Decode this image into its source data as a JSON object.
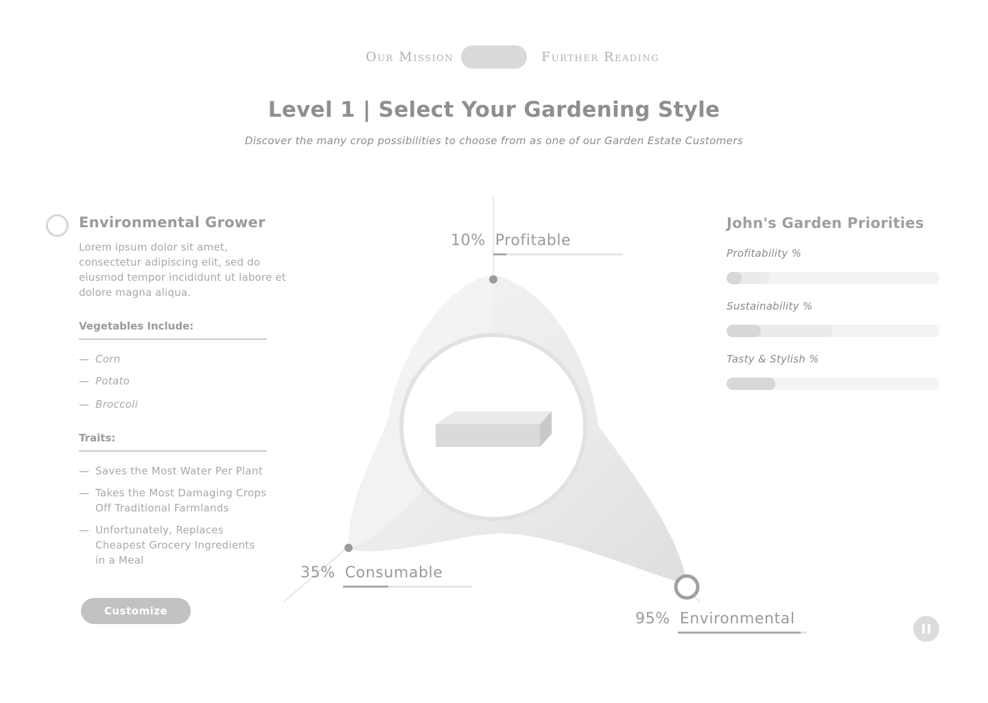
{
  "nav": {
    "left_link": "Our Mission",
    "right_link": "Further Reading"
  },
  "header": {
    "title": "Level 1 | Select Your Gardening Style",
    "subtitle": "Discover the many crop possibilities to choose from as one of our Garden Estate Customers"
  },
  "persona": {
    "title": "Environmental Grower",
    "description": "Lorem ipsum dolor sit amet, consectetur adipiscing elit, sed do eiusmod tempor incididunt ut labore et dolore magna aliqua.",
    "vegetables_heading": "Vegetables Include:",
    "vegetables": [
      "Corn",
      "Potato",
      "Broccoli"
    ],
    "traits_heading": "Traits:",
    "traits": [
      "Saves the Most Water Per Plant",
      "Takes the Most Damaging Crops Off Traditional Farmlands",
      "Unfortunately, Replaces Cheapest Grocery Ingredients in a Meal"
    ],
    "dash": "—",
    "customize_label": "Customize"
  },
  "chart": {
    "profitable": {
      "pct": "10%",
      "label": "Profitable",
      "value": 0.1
    },
    "consumable": {
      "pct": "35%",
      "label": "Consumable",
      "value": 0.35
    },
    "environmental": {
      "pct": "95%",
      "label": "Environmental",
      "value": 0.95
    }
  },
  "priorities": {
    "title": "John's Garden Priorities",
    "items": [
      {
        "label": "Profitability %",
        "value": 0.07,
        "secondary": 0.2
      },
      {
        "label": "Sustainability %",
        "value": 0.16,
        "secondary": 0.5
      },
      {
        "label": "Tasty & Stylish %",
        "value": 0.23,
        "secondary": 0.23
      }
    ]
  },
  "icons": {
    "pause": "pause-icon",
    "radio": "radio-icon",
    "box": "box-icon"
  },
  "colors": {
    "text": "#9a9a9a",
    "pill": "#d9d9d9",
    "button": "#c2c2c2",
    "bar_fill": "#a8a8a8"
  }
}
